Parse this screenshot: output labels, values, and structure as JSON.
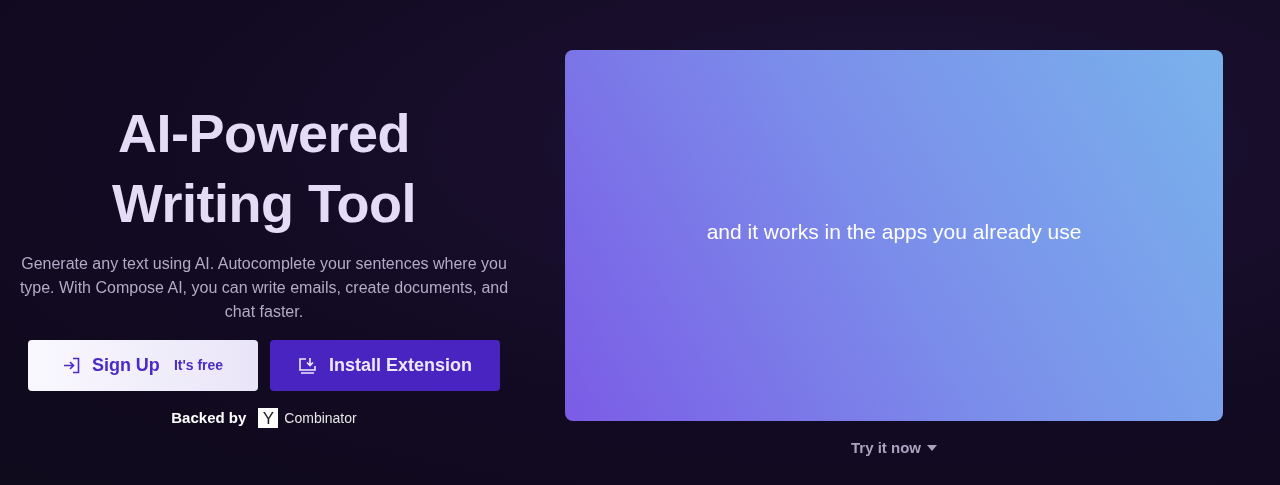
{
  "hero": {
    "title_lines": [
      "AI-Powered",
      "Writing Tool"
    ],
    "description": "Generate any text using AI. Autocomplete your sentences where you type. With Compose AI, you can write emails, create documents, and chat faster.",
    "buttons": [
      {
        "kind": "light",
        "label": "Sign Up",
        "note": "It's free"
      },
      {
        "kind": "primary",
        "label": "Install Extension"
      }
    ],
    "backed_by": {
      "label": "Backed by",
      "logo_letter": "Y",
      "logo_text": "Combinator"
    }
  },
  "video": {
    "caption": "and it works in the apps you already use",
    "link": "Try it now"
  }
}
